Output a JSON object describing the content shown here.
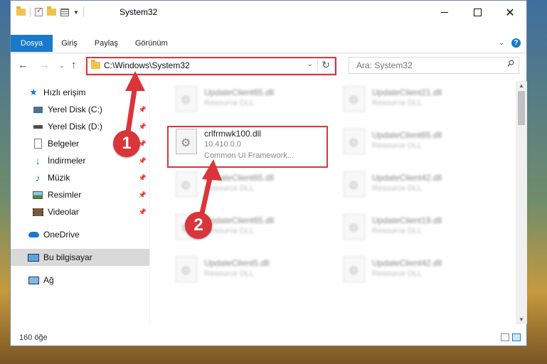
{
  "window": {
    "title": "System32"
  },
  "ribbon": {
    "tabs": [
      "Dosya",
      "Giriş",
      "Paylaş",
      "Görünüm"
    ],
    "help": "?"
  },
  "nav": {
    "address": "C:\\Windows\\System32",
    "search_placeholder": "Ara: System32"
  },
  "sidebar": {
    "items": [
      {
        "label": "Hızlı erişim",
        "icon": "star-icon"
      },
      {
        "label": "Yerel Disk (C:)",
        "icon": "drive-icon"
      },
      {
        "label": "Yerel Disk (D:)",
        "icon": "drive-icon"
      },
      {
        "label": "Belgeler",
        "icon": "document-icon"
      },
      {
        "label": "İndirmeler",
        "icon": "download-icon"
      },
      {
        "label": "Müzik",
        "icon": "music-icon"
      },
      {
        "label": "Resimler",
        "icon": "image-icon"
      },
      {
        "label": "Videolar",
        "icon": "video-icon"
      },
      {
        "label": "OneDrive",
        "icon": "cloud-icon"
      },
      {
        "label": "Bu bilgisayar",
        "icon": "computer-icon"
      },
      {
        "label": "Ağ",
        "icon": "network-icon"
      }
    ]
  },
  "files": [
    {
      "name": "UpdateClient65.dll",
      "type": "Resource DLL"
    },
    {
      "name": "UpdateClient21.dll",
      "type": "Resource DLL"
    },
    {
      "name": "crlfrmwk100.dll",
      "version": "10.410.0.0",
      "desc": "Common UI Framework..."
    },
    {
      "name": "UpdateClient65.dll",
      "type": "Resource DLL"
    },
    {
      "name": "UpdateClient65.dll",
      "type": "Resource DLL"
    },
    {
      "name": "UpdateClient42.dll",
      "type": "Resource DLL"
    },
    {
      "name": "UpdateClient65.dll",
      "type": "Resource DLL"
    },
    {
      "name": "UpdateClient19.dll",
      "type": "Resource DLL"
    },
    {
      "name": "UpdateClient5.dll",
      "type": "Resource DLL"
    },
    {
      "name": "UpdateClient42.dll",
      "type": "Resource DLL"
    }
  ],
  "status": {
    "count": "160 öğe"
  },
  "annotations": {
    "step1": "1",
    "step2": "2"
  },
  "colors": {
    "accent": "#1979ca",
    "highlight": "#d9353a",
    "folder": "#f0c44c"
  }
}
